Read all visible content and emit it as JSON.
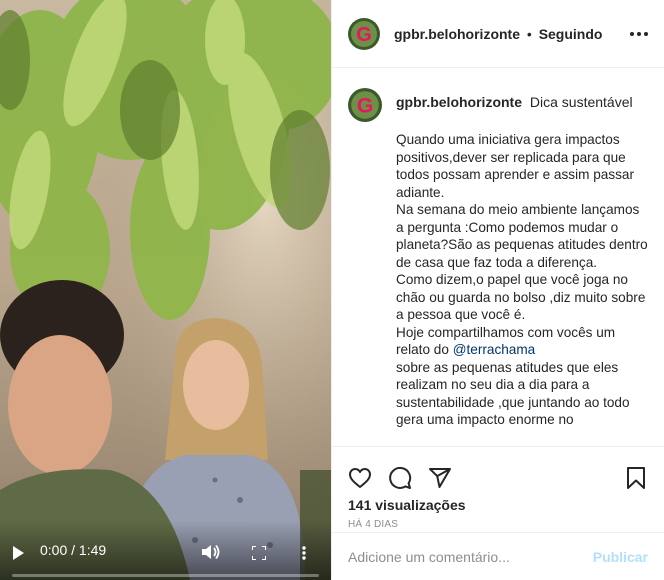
{
  "video": {
    "time": "0:00 / 1:49",
    "progress": 0,
    "icons": [
      "play-icon",
      "volume-icon",
      "fullscreen-icon",
      "more-vertical-icon"
    ]
  },
  "header": {
    "username": "gpbr.belohorizonte",
    "separator": "•",
    "follow_status": "Seguindo",
    "avatar_letter": "G",
    "brand_color": "#e5185d"
  },
  "caption": {
    "username": "gpbr.belohorizonte",
    "title": "Dica sustentável",
    "text_before_mention": "Quando uma iniciativa gera impactos positivos,dever ser replicada para que todos possam aprender e assim passar adiante.\nNa semana do meio ambiente lançamos a pergunta :Como podemos mudar o planeta?São as pequenas atitudes dentro de casa que faz toda a diferença.\nComo dizem,o papel que você joga no chão ou guarda no bolso ,diz muito sobre a pessoa que você é.\nHoje compartilhamos com vocês um relato do ",
    "mention": "@terrachama",
    "text_after_mention": "\nsobre as pequenas atitudes que eles realizam no seu dia a dia para a sustentabilidade ,que juntando ao todo gera uma impacto enorme no"
  },
  "actions": {
    "icons": [
      "heart-icon",
      "comment-icon",
      "share-icon",
      "bookmark-icon"
    ],
    "views": "141 visualizações",
    "date": "HÁ 4 DIAS"
  },
  "comment_box": {
    "placeholder": "Adicione um comentário...",
    "publish_label": "Publicar"
  }
}
